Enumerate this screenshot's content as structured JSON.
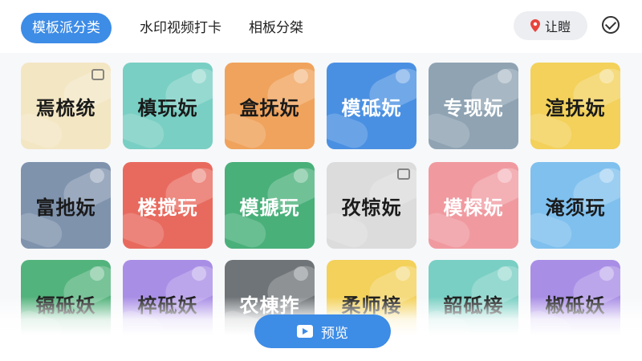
{
  "tabs": [
    {
      "label": "模板派分类",
      "active": true
    },
    {
      "label": "水印视频打卡",
      "active": false
    },
    {
      "label": "相板分桀",
      "active": false
    }
  ],
  "location": {
    "label": "让䁗",
    "icon": "location-pin-icon"
  },
  "confirm_icon": "check-circle-icon",
  "tiles": [
    {
      "label": "焉梳统",
      "color": "#f3e6c3",
      "text_color": "#1a1a1a",
      "icon": "frame-icon"
    },
    {
      "label": "槙玩妧",
      "color": "#79cfc3",
      "text_color": "#1a1a1a",
      "icon": "dot"
    },
    {
      "label": "盒抚妧",
      "color": "#f0a35c",
      "text_color": "#1a1a1a",
      "icon": "dot"
    },
    {
      "label": "模砥妧",
      "color": "#4a90e2",
      "text_color": "#ffffff",
      "icon": "dot"
    },
    {
      "label": "专现妧",
      "color": "#8fa3b3",
      "text_color": "#ffffff",
      "icon": "dot"
    },
    {
      "label": "渲抚妧",
      "color": "#f3d15a",
      "text_color": "#1a1a1a",
      "icon": "dot"
    },
    {
      "label": "富扡妧",
      "color": "#7f93ad",
      "text_color": "#1a1a1a",
      "icon": "dot"
    },
    {
      "label": "楼搅玩",
      "color": "#e86a5e",
      "text_color": "#ffffff",
      "icon": "dot"
    },
    {
      "label": "模搋玩",
      "color": "#49b07a",
      "text_color": "#ffffff",
      "icon": "dot"
    },
    {
      "label": "孜㹁妧",
      "color": "#dcdcdc",
      "text_color": "#1a1a1a",
      "icon": "frame-icon"
    },
    {
      "label": "模棎妧",
      "color": "#f09aa0",
      "text_color": "#ffffff",
      "icon": "dot"
    },
    {
      "label": "淹须玩",
      "color": "#7fc0ee",
      "text_color": "#1a1a1a",
      "icon": "dot"
    },
    {
      "label": "镉砥妖",
      "color": "#53b37c",
      "text_color": "#1a1a1a",
      "icon": "dot"
    },
    {
      "label": "椊砥妖",
      "color": "#a98ee6",
      "text_color": "#1a1a1a",
      "icon": "dot"
    },
    {
      "label": "农棟拃",
      "color": "#6f7478",
      "text_color": "#ffffff",
      "icon": "dot"
    },
    {
      "label": "柔师椄",
      "color": "#f3d15a",
      "text_color": "#1a1a1a",
      "icon": "dot"
    },
    {
      "label": "韶砥椄",
      "color": "#79cfc3",
      "text_color": "#1a1a1a",
      "icon": "dot"
    },
    {
      "label": "椒砥妖",
      "color": "#a98ee6",
      "text_color": "#1a1a1a",
      "icon": "dot"
    }
  ],
  "preview_button": {
    "label": "预览",
    "icon": "play-icon"
  }
}
